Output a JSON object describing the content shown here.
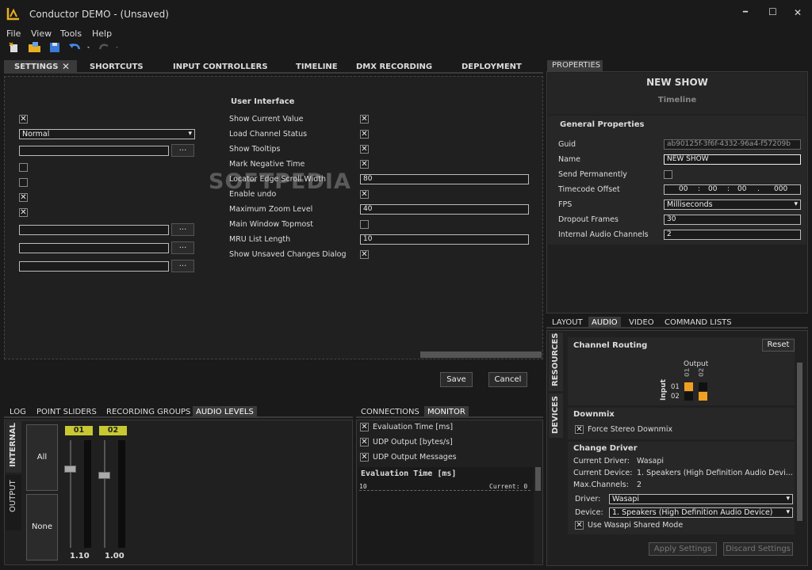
{
  "window": {
    "title": "Conductor DEMO - (Unsaved)",
    "minimize": "━",
    "maximize": "☐",
    "close": "✕"
  },
  "menu": {
    "file": "File",
    "view": "View",
    "tools": "Tools",
    "help": "Help"
  },
  "tabs": {
    "settings": "SETTINGS",
    "shortcuts": "SHORTCUTS",
    "input_controllers": "INPUT CONTROLLERS",
    "timeline": "TIMELINE",
    "dmx_recording": "DMX RECORDING",
    "deployment": "DEPLOYMENT"
  },
  "settings": {
    "heading": "User Interface",
    "left": {
      "dropdown": "Normal",
      "browse": "..."
    },
    "rows": [
      {
        "label": "Show Current Value",
        "type": "check",
        "checked": true
      },
      {
        "label": "Load Channel Status",
        "type": "check",
        "checked": true
      },
      {
        "label": "Show Tooltips",
        "type": "check",
        "checked": true
      },
      {
        "label": "Mark Negative Time",
        "type": "check",
        "checked": true
      },
      {
        "label": "Locator Edge Scroll Width",
        "type": "input",
        "value": "80"
      },
      {
        "label": "Enable undo",
        "type": "check",
        "checked": true
      },
      {
        "label": "Maximum Zoom Level",
        "type": "input",
        "value": "40"
      },
      {
        "label": "Main Window Topmost",
        "type": "check",
        "checked": false
      },
      {
        "label": "MRU List Length",
        "type": "input",
        "value": "10"
      },
      {
        "label": "Show Unsaved Changes Dialog",
        "type": "check",
        "checked": true
      }
    ],
    "save": "Save",
    "cancel": "Cancel",
    "check_mark": "✕"
  },
  "bottom_left": {
    "tabs": {
      "log": "LOG",
      "point_sliders": "POINT SLIDERS",
      "recording_groups": "RECORDING GROUPS",
      "audio_levels": "AUDIO LEVELS"
    },
    "side_tabs": {
      "internal": "INTERNAL",
      "output": "OUTPUT"
    },
    "all": "All",
    "none": "None",
    "ch1": {
      "label": "01",
      "value": "1.10",
      "level": 0.72
    },
    "ch2": {
      "label": "02",
      "value": "1.00",
      "level": 0.65
    }
  },
  "monitor": {
    "tabs": {
      "connections": "CONNECTIONS",
      "monitor": "MONITOR"
    },
    "items": [
      "Evaluation Time [ms]",
      "UDP Output [bytes/s]",
      "UDP Output Messages"
    ],
    "graph_title": "Evaluation Time [ms]",
    "graph_scale": "10",
    "graph_current": "Current: 0"
  },
  "properties": {
    "tab": "PROPERTIES",
    "title": "NEW SHOW",
    "subtitle": "Timeline",
    "section": "General Properties",
    "guid_label": "Guid",
    "guid": "ab90125f-3f6f-4332-96a4-f57209b",
    "name_label": "Name",
    "name": "NEW SHOW",
    "send_label": "Send Permanently",
    "tc_label": "Timecode Offset",
    "tc": [
      "00",
      "00",
      "00",
      "000"
    ],
    "tc_sep": [
      ":",
      ":",
      "."
    ],
    "fps_label": "FPS",
    "fps": "Milliseconds",
    "dropout_label": "Dropout Frames",
    "dropout": "30",
    "iac_label": "Internal Audio Channels",
    "iac": "2"
  },
  "audio": {
    "tabs": {
      "layout": "LAYOUT",
      "audio": "AUDIO",
      "video": "VIDEO",
      "command_lists": "COMMAND LISTS"
    },
    "side_tabs": {
      "resources": "RESOURCES",
      "devices": "DEVICES"
    },
    "routing_title": "Channel Routing",
    "reset": "Reset",
    "output": "Output",
    "input": "Input",
    "out_labels": [
      "01",
      "02"
    ],
    "in_labels": [
      "01",
      "02"
    ],
    "downmix_title": "Downmix",
    "force_stereo": "Force Stereo Downmix",
    "driver_title": "Change Driver",
    "current_driver_label": "Current Driver:",
    "current_driver": "Wasapi",
    "current_device_label": "Current Device:",
    "current_device": "1. Speakers (High Definition Audio Devi...",
    "max_channels_label": "Max.Channels:",
    "max_channels": "2",
    "driver_label": "Driver:",
    "driver": "Wasapi",
    "device_label": "Device:",
    "device": "1. Speakers (High Definition Audio Device)",
    "shared_mode": "Use Wasapi Shared Mode",
    "apply": "Apply Settings",
    "discard": "Discard Settings"
  },
  "watermark": "SOFTPEDIA"
}
